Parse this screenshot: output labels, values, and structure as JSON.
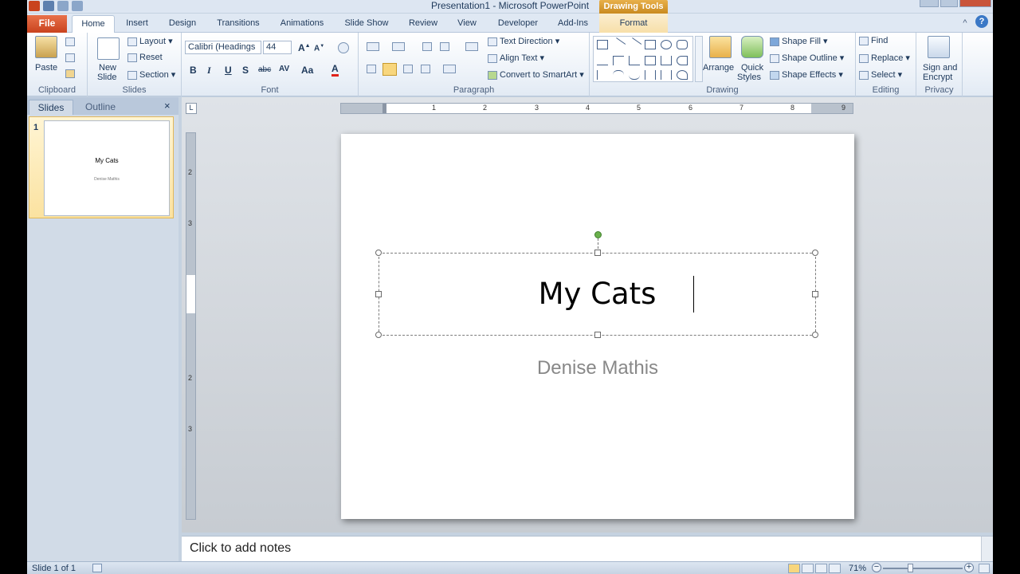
{
  "window": {
    "title": "Presentation1  -  Microsoft PowerPoint",
    "contextual_tab_group": "Drawing Tools"
  },
  "tabs": {
    "file": "File",
    "home": "Home",
    "insert": "Insert",
    "design": "Design",
    "transitions": "Transitions",
    "animations": "Animations",
    "slideshow": "Slide Show",
    "review": "Review",
    "view": "View",
    "developer": "Developer",
    "addins": "Add-Ins",
    "format": "Format"
  },
  "ribbon": {
    "clipboard": {
      "label": "Clipboard",
      "paste": "Paste"
    },
    "slides": {
      "label": "Slides",
      "new_slide": "New",
      "new_slide2": "Slide",
      "layout": "Layout",
      "reset": "Reset",
      "section": "Section"
    },
    "font": {
      "label": "Font",
      "font_name": "Calibri (Headings",
      "font_size": "44",
      "bold": "B",
      "italic": "I",
      "underline": "U",
      "shadow": "S",
      "strike": "abc",
      "spacing": "AV",
      "case": "Aa",
      "color": "A"
    },
    "paragraph": {
      "label": "Paragraph",
      "text_direction": "Text Direction",
      "align_text": "Align Text",
      "smartart": "Convert to SmartArt"
    },
    "drawing": {
      "label": "Drawing",
      "arrange": "Arrange",
      "quick_styles": "Quick",
      "quick_styles2": "Styles",
      "shape_fill": "Shape Fill",
      "shape_outline": "Shape Outline",
      "shape_effects": "Shape Effects"
    },
    "editing": {
      "label": "Editing",
      "find": "Find",
      "replace": "Replace",
      "select": "Select"
    },
    "privacy": {
      "label": "Privacy",
      "sign": "Sign and",
      "encrypt": "Encrypt"
    }
  },
  "left_panel": {
    "tab_slides": "Slides",
    "tab_outline": "Outline",
    "close": "×",
    "thumb_number": "1",
    "thumb_title": "My Cats",
    "thumb_subtitle": "Denise Mathis"
  },
  "ruler": {
    "h_numbers": [
      "1",
      "2",
      "3",
      "4",
      "5",
      "6",
      "7",
      "8",
      "9"
    ],
    "v_numbers": [
      "2",
      "3",
      "2",
      "3"
    ]
  },
  "slide": {
    "title": "My Cats",
    "subtitle": "Denise Mathis"
  },
  "notes": {
    "placeholder": "Click to add notes"
  },
  "status": {
    "slide_info": "Slide 1 of 1",
    "zoom": "71%",
    "zoom_out": "−",
    "zoom_in": "+"
  },
  "colors": {
    "file_tab": "#c9431e",
    "drawing_tools": "#e8b04a",
    "rotate_handle": "#6ab04c"
  }
}
